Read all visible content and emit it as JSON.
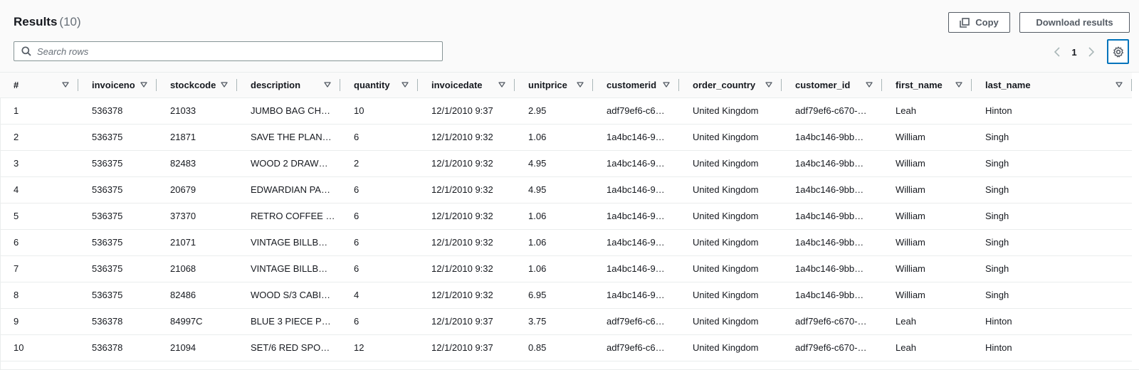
{
  "header": {
    "title": "Results",
    "count": "(10)",
    "copy_label": "Copy",
    "download_label": "Download results"
  },
  "search": {
    "placeholder": "Search rows",
    "value": ""
  },
  "pagination": {
    "current_page": "1",
    "prev_icon": "chevron-left-icon",
    "next_icon": "chevron-right-icon"
  },
  "settings": {
    "icon": "gear-icon"
  },
  "table": {
    "columns": [
      "#",
      "invoiceno",
      "stockcode",
      "description",
      "quantity",
      "invoicedate",
      "unitprice",
      "customerid",
      "order_country",
      "customer_id",
      "first_name",
      "last_name"
    ],
    "rows": [
      [
        "1",
        "536378",
        "21033",
        "JUMBO BAG CH…",
        "10",
        "12/1/2010 9:37",
        "2.95",
        "adf79ef6-c6…",
        "United Kingdom",
        "adf79ef6-c670-…",
        "Leah",
        "Hinton"
      ],
      [
        "2",
        "536375",
        "21871",
        "SAVE THE PLAN…",
        "6",
        "12/1/2010 9:32",
        "1.06",
        "1a4bc146-9…",
        "United Kingdom",
        "1a4bc146-9bb…",
        "William",
        "Singh"
      ],
      [
        "3",
        "536375",
        "82483",
        "WOOD 2 DRAW…",
        "2",
        "12/1/2010 9:32",
        "4.95",
        "1a4bc146-9…",
        "United Kingdom",
        "1a4bc146-9bb…",
        "William",
        "Singh"
      ],
      [
        "4",
        "536375",
        "20679",
        "EDWARDIAN PA…",
        "6",
        "12/1/2010 9:32",
        "4.95",
        "1a4bc146-9…",
        "United Kingdom",
        "1a4bc146-9bb…",
        "William",
        "Singh"
      ],
      [
        "5",
        "536375",
        "37370",
        "RETRO COFFEE …",
        "6",
        "12/1/2010 9:32",
        "1.06",
        "1a4bc146-9…",
        "United Kingdom",
        "1a4bc146-9bb…",
        "William",
        "Singh"
      ],
      [
        "6",
        "536375",
        "21071",
        "VINTAGE BILLB…",
        "6",
        "12/1/2010 9:32",
        "1.06",
        "1a4bc146-9…",
        "United Kingdom",
        "1a4bc146-9bb…",
        "William",
        "Singh"
      ],
      [
        "7",
        "536375",
        "21068",
        "VINTAGE BILLB…",
        "6",
        "12/1/2010 9:32",
        "1.06",
        "1a4bc146-9…",
        "United Kingdom",
        "1a4bc146-9bb…",
        "William",
        "Singh"
      ],
      [
        "8",
        "536375",
        "82486",
        "WOOD S/3 CABI…",
        "4",
        "12/1/2010 9:32",
        "6.95",
        "1a4bc146-9…",
        "United Kingdom",
        "1a4bc146-9bb…",
        "William",
        "Singh"
      ],
      [
        "9",
        "536378",
        "84997C",
        "BLUE 3 PIECE P…",
        "6",
        "12/1/2010 9:37",
        "3.75",
        "adf79ef6-c6…",
        "United Kingdom",
        "adf79ef6-c670-…",
        "Leah",
        "Hinton"
      ],
      [
        "10",
        "536378",
        "21094",
        "SET/6 RED SPO…",
        "12",
        "12/1/2010 9:37",
        "0.85",
        "adf79ef6-c6…",
        "United Kingdom",
        "adf79ef6-c670-…",
        "Leah",
        "Hinton"
      ]
    ]
  },
  "colors": {
    "accent": "#0073bb",
    "text": "#16191f",
    "muted": "#687078",
    "border": "#eaeded"
  }
}
